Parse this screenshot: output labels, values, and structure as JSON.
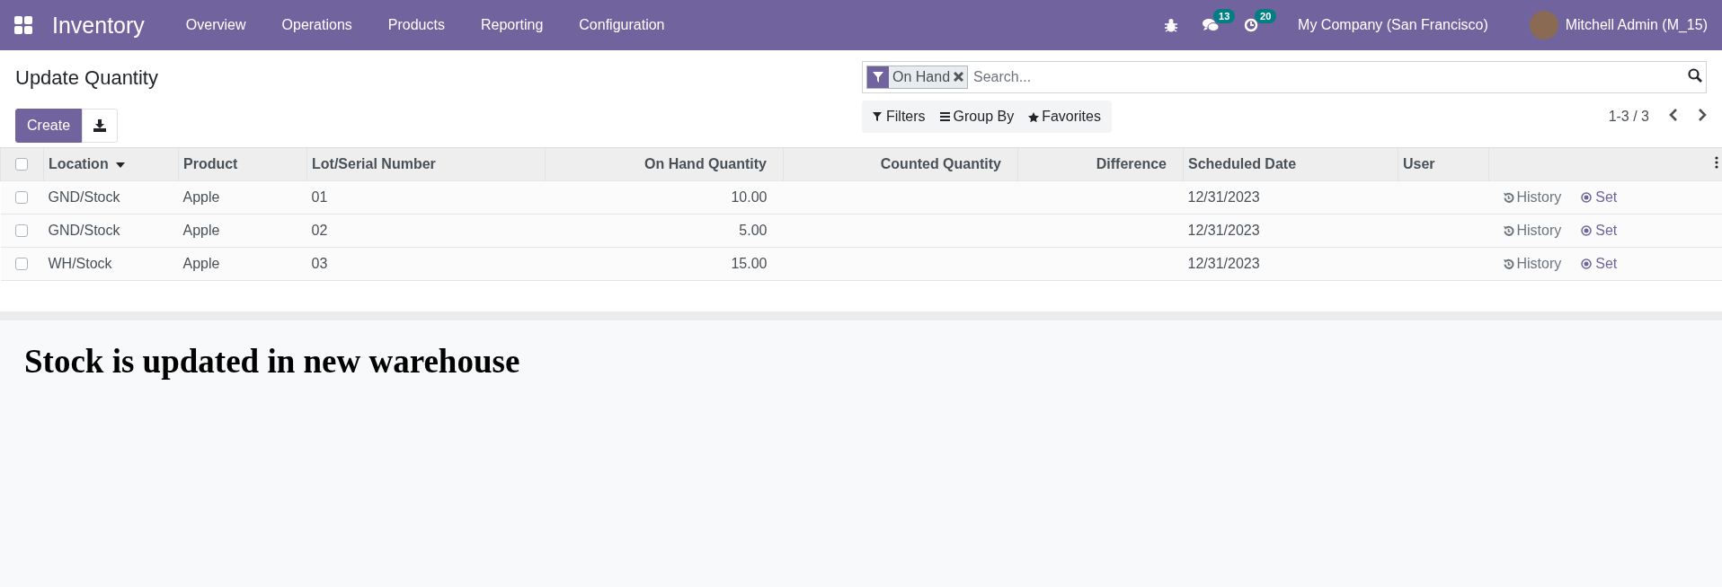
{
  "navbar": {
    "app_name": "Inventory",
    "menu": [
      "Overview",
      "Operations",
      "Products",
      "Reporting",
      "Configuration"
    ],
    "messages_count": "13",
    "activities_count": "20",
    "company": "My Company (San Francisco)",
    "user": "Mitchell Admin (M_15)"
  },
  "control_panel": {
    "title": "Update Quantity",
    "create_label": "Create",
    "search": {
      "facets": [
        {
          "label": "On Hand"
        }
      ],
      "placeholder": "Search..."
    },
    "filter_buttons": [
      "Filters",
      "Group By",
      "Favorites"
    ],
    "pager": "1-3 / 3"
  },
  "table": {
    "all_checked": false,
    "columns": [
      {
        "label": "Location",
        "sorted": true
      },
      {
        "label": "Product",
        "sorted": false
      },
      {
        "label": "Lot/Serial Number",
        "sorted": false
      },
      {
        "label": "On Hand Quantity",
        "sorted": false
      },
      {
        "label": "Counted Quantity",
        "sorted": false
      },
      {
        "label": "Difference",
        "sorted": false
      },
      {
        "label": "Scheduled Date",
        "sorted": false
      },
      {
        "label": "User",
        "sorted": false
      }
    ],
    "rows": [
      {
        "checked": false,
        "cells": [
          "GND/Stock",
          "Apple",
          "01",
          "10.00",
          "",
          "",
          "12/31/2023",
          ""
        ],
        "history": "History",
        "set": "Set"
      },
      {
        "checked": false,
        "cells": [
          "GND/Stock",
          "Apple",
          "02",
          "5.00",
          "",
          "",
          "12/31/2023",
          ""
        ],
        "history": "History",
        "set": "Set"
      },
      {
        "checked": false,
        "cells": [
          "WH/Stock",
          "Apple",
          "03",
          "15.00",
          "",
          "",
          "12/31/2023",
          ""
        ],
        "history": "History",
        "set": "Set"
      }
    ]
  },
  "caption": "Stock is updated in new warehouse"
}
